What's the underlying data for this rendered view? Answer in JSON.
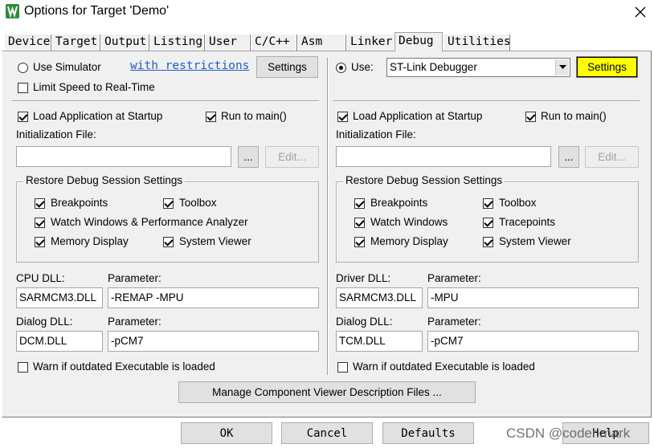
{
  "window": {
    "title": "Options for Target 'Demo'",
    "close_glyph": "✕"
  },
  "tabs": [
    {
      "label": "Device"
    },
    {
      "label": "Target"
    },
    {
      "label": "Output"
    },
    {
      "label": "Listing"
    },
    {
      "label": "User"
    },
    {
      "label": "C/C++"
    },
    {
      "label": "Asm"
    },
    {
      "label": "Linker"
    },
    {
      "label": "Debug"
    },
    {
      "label": "Utilities"
    }
  ],
  "active_tab": "Debug",
  "left": {
    "use_simulator": {
      "label": "Use Simulator",
      "selected": false
    },
    "restrictions_link": "with restrictions",
    "settings_button": "Settings",
    "limit_speed": {
      "label": "Limit Speed to Real-Time",
      "checked": false
    },
    "load_app": {
      "label": "Load Application at Startup",
      "checked": true
    },
    "run_to_main": {
      "label": "Run to main()",
      "checked": true
    },
    "init_file_label": "Initialization File:",
    "init_file_value": "",
    "browse_button": "...",
    "edit_button": "Edit...",
    "restore_group": {
      "title": "Restore Debug Session Settings",
      "breakpoints": {
        "label": "Breakpoints",
        "checked": true
      },
      "toolbox": {
        "label": "Toolbox",
        "checked": true
      },
      "watch_windows": {
        "label": "Watch Windows & Performance Analyzer",
        "checked": true
      },
      "memory_display": {
        "label": "Memory Display",
        "checked": true
      },
      "system_viewer": {
        "label": "System Viewer",
        "checked": true
      }
    },
    "cpu_dll_label": "CPU DLL:",
    "cpu_dll_value": "SARMCM3.DLL",
    "cpu_param_label": "Parameter:",
    "cpu_param_value": "-REMAP -MPU",
    "dialog_dll_label": "Dialog DLL:",
    "dialog_dll_value": "DCM.DLL",
    "dialog_param_label": "Parameter:",
    "dialog_param_value": "-pCM7",
    "warn_outdated": {
      "label": "Warn if outdated Executable is loaded",
      "checked": false
    }
  },
  "right": {
    "use": {
      "label": "Use:",
      "selected": true
    },
    "debugger_select": "ST-Link Debugger",
    "settings_button": "Settings",
    "load_app": {
      "label": "Load Application at Startup",
      "checked": true
    },
    "run_to_main": {
      "label": "Run to main()",
      "checked": true
    },
    "init_file_label": "Initialization File:",
    "init_file_value": "",
    "browse_button": "...",
    "edit_button": "Edit...",
    "restore_group": {
      "title": "Restore Debug Session Settings",
      "breakpoints": {
        "label": "Breakpoints",
        "checked": true
      },
      "toolbox": {
        "label": "Toolbox",
        "checked": true
      },
      "watch_windows": {
        "label": "Watch Windows",
        "checked": true
      },
      "tracepoints": {
        "label": "Tracepoints",
        "checked": true
      },
      "memory_display": {
        "label": "Memory Display",
        "checked": true
      },
      "system_viewer": {
        "label": "System Viewer",
        "checked": true
      }
    },
    "driver_dll_label": "Driver DLL:",
    "driver_dll_value": "SARMCM3.DLL",
    "driver_param_label": "Parameter:",
    "driver_param_value": "-MPU",
    "dialog_dll_label": "Dialog DLL:",
    "dialog_dll_value": "TCM.DLL",
    "dialog_param_label": "Parameter:",
    "dialog_param_value": "-pCM7",
    "warn_outdated": {
      "label": "Warn if outdated Executable is loaded",
      "checked": false
    }
  },
  "manage_button": "Manage Component Viewer Description Files ...",
  "footer": {
    "ok": "OK",
    "cancel": "Cancel",
    "defaults": "Defaults",
    "help": "Help"
  },
  "watermark": "CSDN @coder.mark",
  "colors": {
    "highlight": "#ffff00",
    "link": "#1c5bd6",
    "panel": "#f0f0f0"
  }
}
